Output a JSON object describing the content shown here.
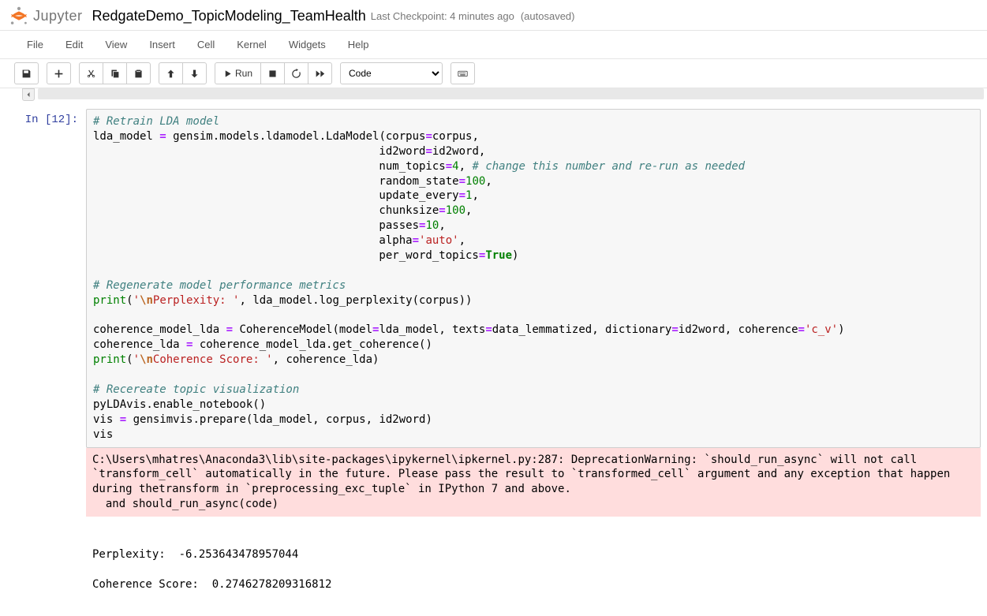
{
  "header": {
    "logo_text": "Jupyter",
    "notebook_title": "RedgateDemo_TopicModeling_TeamHealth",
    "checkpoint": "Last Checkpoint: 4 minutes ago",
    "autosave": "(autosaved)"
  },
  "menu": {
    "file": "File",
    "edit": "Edit",
    "view": "View",
    "insert": "Insert",
    "cell": "Cell",
    "kernel": "Kernel",
    "widgets": "Widgets",
    "help": "Help"
  },
  "toolbar": {
    "run_label": "Run",
    "cell_type": "Code"
  },
  "cell": {
    "prompt": "In [12]:",
    "code_lines": [
      {
        "t": "comment",
        "text": "# Retrain LDA model"
      },
      {
        "t": "code",
        "tokens": [
          "lda_model",
          " ",
          "=op",
          " ",
          "gensim",
          ".",
          "models",
          ".",
          "ldamodel",
          ".",
          "LdaModel",
          "(",
          "corpus",
          "=op",
          "corpus",
          ","
        ]
      },
      {
        "t": "indent",
        "pad": "                                           ",
        "tokens": [
          "id2word",
          "=op",
          "id2word",
          ","
        ]
      },
      {
        "t": "indent",
        "pad": "                                           ",
        "tokens": [
          "num_topics",
          "=op",
          "4num",
          ",",
          " ",
          "# change this number and re-run as neededcm"
        ]
      },
      {
        "t": "indent",
        "pad": "                                           ",
        "tokens": [
          "random_state",
          "=op",
          "100num",
          ","
        ]
      },
      {
        "t": "indent",
        "pad": "                                           ",
        "tokens": [
          "update_every",
          "=op",
          "1num",
          ","
        ]
      },
      {
        "t": "indent",
        "pad": "                                           ",
        "tokens": [
          "chunksize",
          "=op",
          "100num",
          ","
        ]
      },
      {
        "t": "indent",
        "pad": "                                           ",
        "tokens": [
          "passes",
          "=op",
          "10num",
          ","
        ]
      },
      {
        "t": "indent",
        "pad": "                                           ",
        "tokens": [
          "alpha",
          "=op",
          "'auto'str",
          ","
        ]
      },
      {
        "t": "indent",
        "pad": "                                           ",
        "tokens": [
          "per_word_topics",
          "=op",
          "Truebool",
          ")"
        ]
      },
      {
        "t": "blank"
      },
      {
        "t": "comment",
        "text": "# Regenerate model performance metrics"
      },
      {
        "t": "code",
        "tokens": [
          "printbn",
          "(",
          "'str",
          "\\nesc",
          "Perplexity: 'str",
          ",",
          " ",
          "lda_model",
          ".",
          "log_perplexity",
          "(",
          "corpus",
          ")",
          ")"
        ]
      },
      {
        "t": "blank"
      },
      {
        "t": "code",
        "tokens": [
          "coherence_model_lda",
          " ",
          "=op",
          " ",
          "CoherenceModel",
          "(",
          "model",
          "=op",
          "lda_model",
          ",",
          " ",
          "texts",
          "=op",
          "data_lemmatized",
          ",",
          " ",
          "dictionary",
          "=op",
          "id2word",
          ",",
          " ",
          "coherence",
          "=op",
          "'c_v'str",
          ")"
        ]
      },
      {
        "t": "code",
        "tokens": [
          "coherence_lda",
          " ",
          "=op",
          " ",
          "coherence_model_lda",
          ".",
          "get_coherence",
          "(",
          ")"
        ]
      },
      {
        "t": "code",
        "tokens": [
          "printbn",
          "(",
          "'str",
          "\\nesc",
          "Coherence Score: 'str",
          ",",
          " ",
          "coherence_lda",
          ")"
        ]
      },
      {
        "t": "blank"
      },
      {
        "t": "comment",
        "text": "# Recereate topic visualization"
      },
      {
        "t": "code",
        "tokens": [
          "pyLDAvis",
          ".",
          "enable_notebook",
          "(",
          ")"
        ]
      },
      {
        "t": "code",
        "tokens": [
          "vis",
          " ",
          "=op",
          " ",
          "gensimvis",
          ".",
          "prepare",
          "(",
          "lda_model",
          ",",
          " ",
          "corpus",
          ",",
          " ",
          "id2word",
          ")"
        ]
      },
      {
        "t": "code",
        "tokens": [
          "vis"
        ]
      }
    ],
    "stderr": "C:\\Users\\mhatres\\Anaconda3\\lib\\site-packages\\ipykernel\\ipkernel.py:287: DeprecationWarning: `should_run_async` will not call `transform_cell` automatically in the future. Please pass the result to `transformed_cell` argument and any exception that happen during thetransform in `preprocessing_exc_tuple` in IPython 7 and above.\n  and should_run_async(code)",
    "stdout": "\nPerplexity:  -6.253643478957044\n\nCoherence Score:  0.2746278209316812"
  }
}
